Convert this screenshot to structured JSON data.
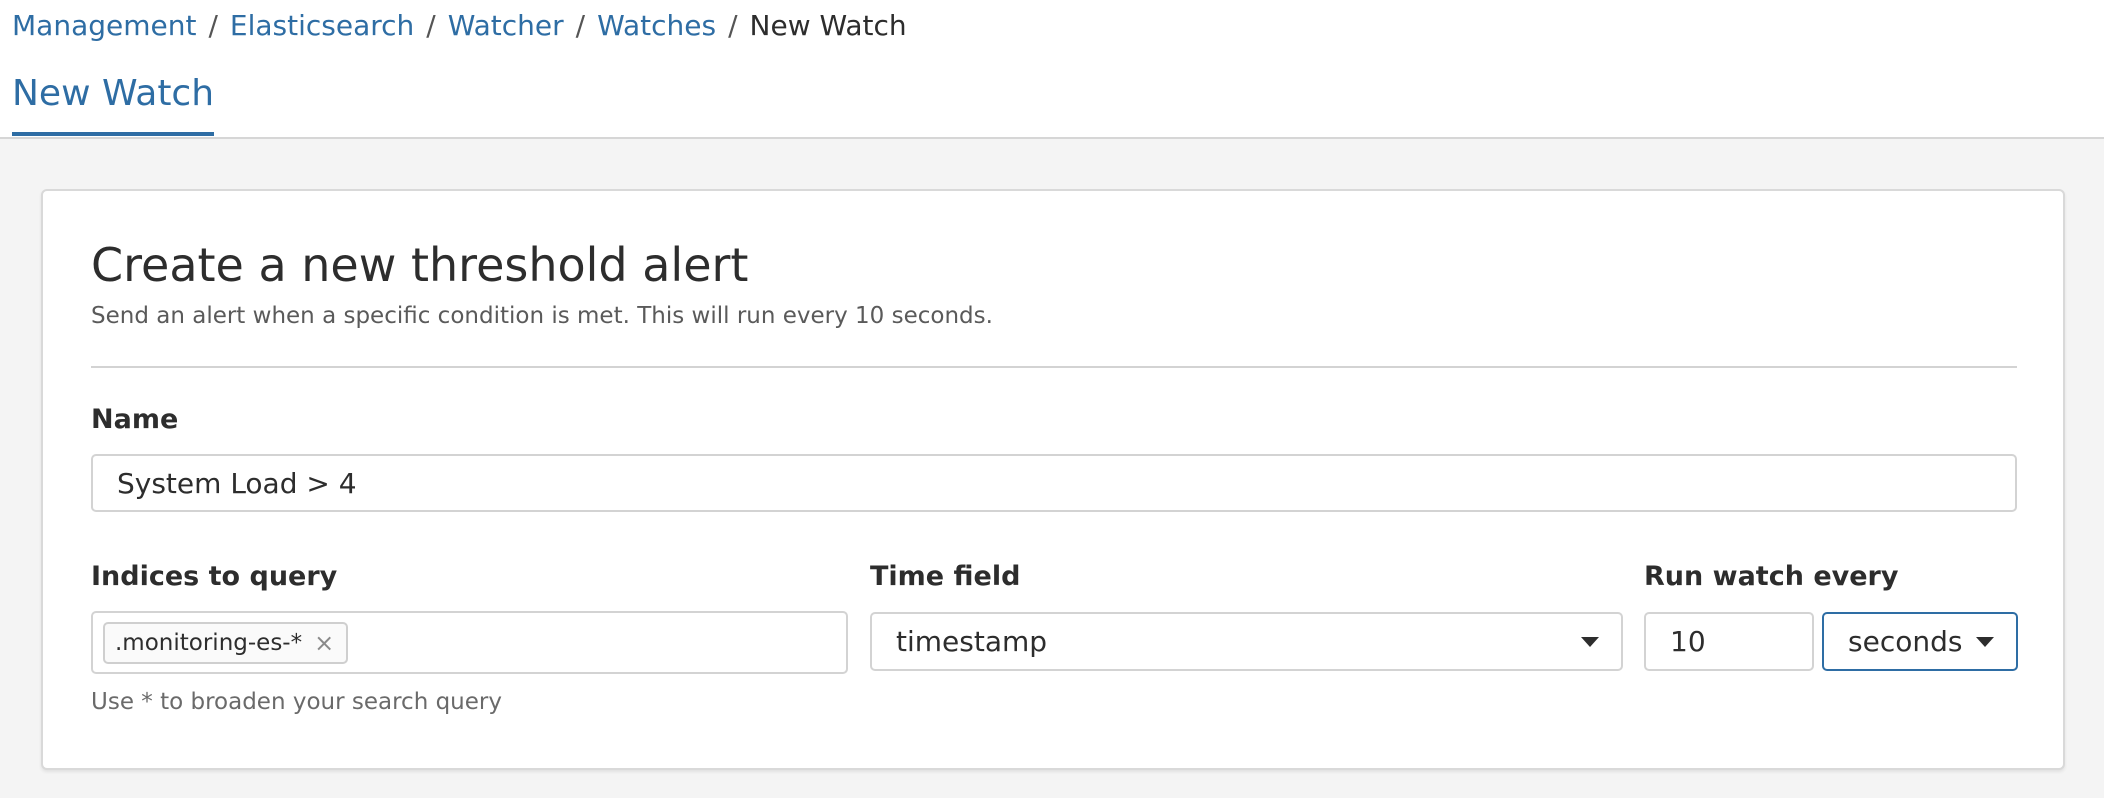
{
  "breadcrumbs": {
    "items": [
      "Management",
      "Elasticsearch",
      "Watcher",
      "Watches"
    ],
    "separator": "/",
    "current": "New Watch"
  },
  "tab": {
    "label": "New Watch"
  },
  "form": {
    "title": "Create a new threshold alert",
    "description": "Send an alert when a specific condition is met. This will run every 10 seconds.",
    "name": {
      "label": "Name",
      "value": "System Load > 4"
    },
    "indices": {
      "label": "Indices to query",
      "chip": ".monitoring-es-*",
      "chip_remove": "×",
      "help": "Use * to broaden your search query"
    },
    "time_field": {
      "label": "Time field",
      "value": "timestamp"
    },
    "run_every": {
      "label": "Run watch every",
      "value": "10",
      "unit": "seconds"
    }
  },
  "colors": {
    "link": "#2e6da4",
    "focus_border": "#2e6da4",
    "background": "#f4f4f4"
  }
}
